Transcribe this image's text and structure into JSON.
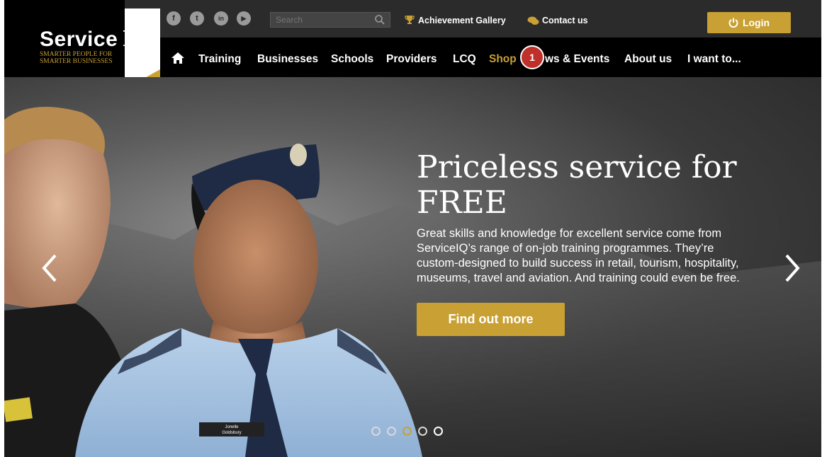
{
  "logo": {
    "brand": "Service",
    "brand_suffix": "IQ",
    "tagline": "SMARTER PEOPLE FOR SMARTER BUSINESSES"
  },
  "social": [
    {
      "name": "facebook-icon",
      "glyph": "f"
    },
    {
      "name": "twitter-icon",
      "glyph": "t"
    },
    {
      "name": "linkedin-icon",
      "glyph": "in"
    },
    {
      "name": "youtube-icon",
      "glyph": "▶"
    }
  ],
  "search": {
    "placeholder": "Search"
  },
  "toplinks": {
    "achievement": "Achievement Gallery",
    "contact": "Contact us",
    "login": "Login"
  },
  "nav": {
    "training": "Training",
    "businesses": "Businesses",
    "schools": "Schools",
    "providers": "Providers",
    "lcq": "LCQ",
    "shop": "Shop",
    "news": "ws & Events",
    "about": "About us",
    "iwant": "I want to..."
  },
  "badge": "1",
  "hero": {
    "title": "Priceless service for FREE",
    "body": "Great skills and knowledge for excellent service come from ServiceIQ’s range of on-job training programmes. They’re custom-designed to build success in retail, tourism, hospitality, museums, travel and aviation. And training could even be free.",
    "cta": "Find out more",
    "nametag_line1": "Jonelle",
    "nametag_line2": "Goldsbury"
  },
  "carousel": {
    "count": 5,
    "active_index": 2
  },
  "colors": {
    "accent": "#c9a033",
    "badge": "#c0302a",
    "nav": "#000000",
    "topbar": "#2b2b2b"
  }
}
